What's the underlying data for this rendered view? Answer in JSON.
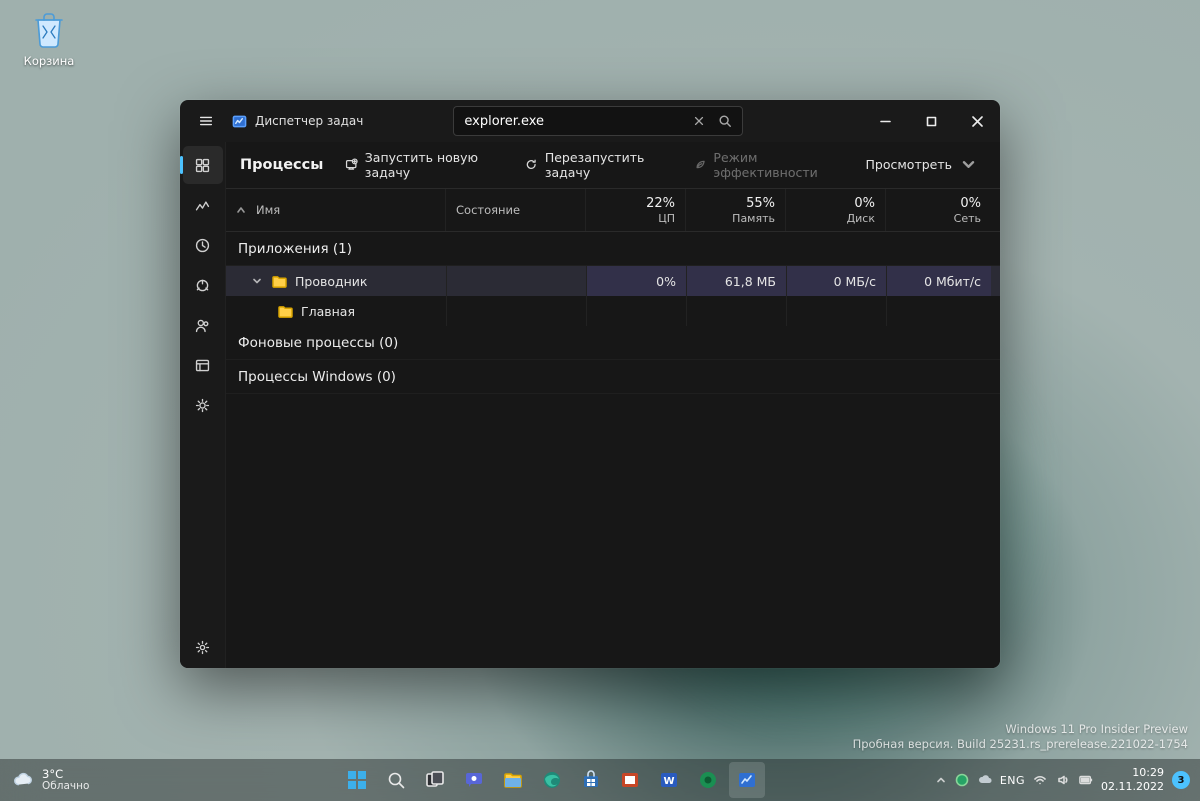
{
  "desktop": {
    "recycle_bin_label": "Корзина",
    "watermark_line1": "Windows 11 Pro Insider Preview",
    "watermark_line2": "Пробная версия. Build 25231.rs_prerelease.221022-1754"
  },
  "taskbar": {
    "temp": "3°C",
    "condition": "Облачно",
    "lang": "ENG",
    "time": "10:29",
    "date": "02.11.2022",
    "notif_count": "3"
  },
  "window": {
    "title": "Диспетчер задач",
    "search_value": "explorer.exe",
    "page_title": "Процессы",
    "toolbar": {
      "new_task": "Запустить новую задачу",
      "restart_task": "Перезапустить задачу",
      "efficiency": "Режим эффективности",
      "view": "Просмотреть"
    },
    "columns": {
      "name": "Имя",
      "status": "Состояние",
      "cpu_pct": "22%",
      "cpu_lbl": "ЦП",
      "mem_pct": "55%",
      "mem_lbl": "Память",
      "disk_pct": "0%",
      "disk_lbl": "Диск",
      "net_pct": "0%",
      "net_lbl": "Сеть"
    },
    "groups": {
      "apps": "Приложения (1)",
      "bg": "Фоновые процессы (0)",
      "win": "Процессы Windows (0)"
    },
    "rows": {
      "explorer": {
        "name": "Проводник",
        "child": "Главная",
        "cpu": "0%",
        "mem": "61,8 МБ",
        "disk": "0 МБ/с",
        "net": "0 Мбит/с"
      }
    }
  }
}
